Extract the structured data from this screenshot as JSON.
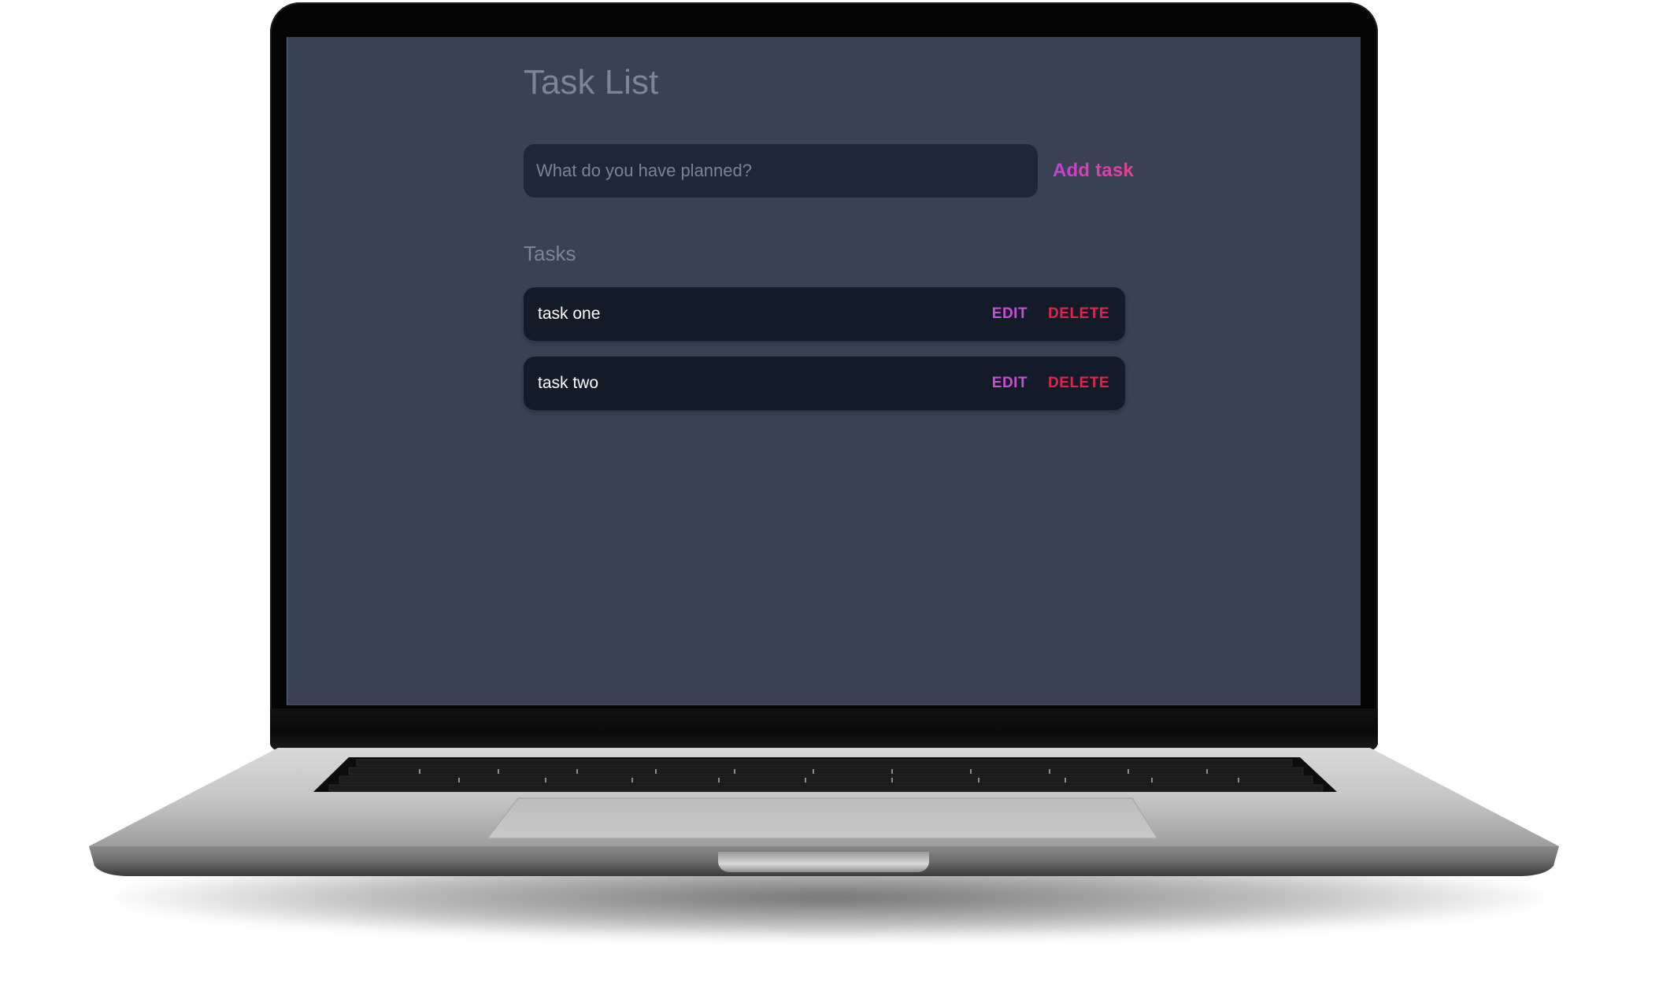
{
  "app": {
    "title": "Task List",
    "input": {
      "placeholder": "What do you have planned?",
      "value": ""
    },
    "add_button_label": "Add task",
    "section_label": "Tasks",
    "tasks": [
      {
        "text": "task one",
        "edit_label": "EDIT",
        "delete_label": "DELETE"
      },
      {
        "text": "task two",
        "edit_label": "EDIT",
        "delete_label": "DELETE"
      }
    ]
  },
  "colors": {
    "background": "#394152",
    "input_background": "#1f2737",
    "task_background": "#131a28",
    "edit": "#c74fd8",
    "delete": "#e0244d",
    "add_gradient_start": "#c740d9",
    "add_gradient_end": "#e0458f"
  }
}
